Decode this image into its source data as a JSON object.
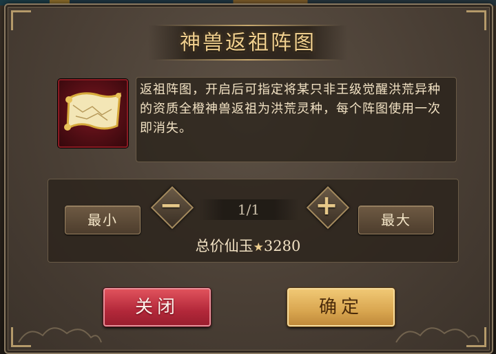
{
  "dialog": {
    "title": "神兽返祖阵图",
    "description": "返祖阵图，开启后可指定将某只非王级觉醒洪荒异种的资质全橙神兽返祖为洪荒灵种，每个阵图使用一次即消失。",
    "item_icon": "scroll-map-icon"
  },
  "quantity": {
    "min_label": "最小",
    "max_label": "最大",
    "minus_icon": "minus-icon",
    "plus_icon": "plus-icon",
    "minus_glyph": "−",
    "plus_glyph": "+",
    "value": "1/1",
    "total_prefix": "总价仙玉",
    "currency_icon": "star-icon",
    "currency_glyph": "★",
    "total_value": "3280"
  },
  "actions": {
    "close_label": "关闭",
    "confirm_label": "确定"
  },
  "colors": {
    "title": "#f0cf8e",
    "close_button": "#c43544",
    "confirm_button": "#e2b060",
    "panel": "#4e4237"
  }
}
